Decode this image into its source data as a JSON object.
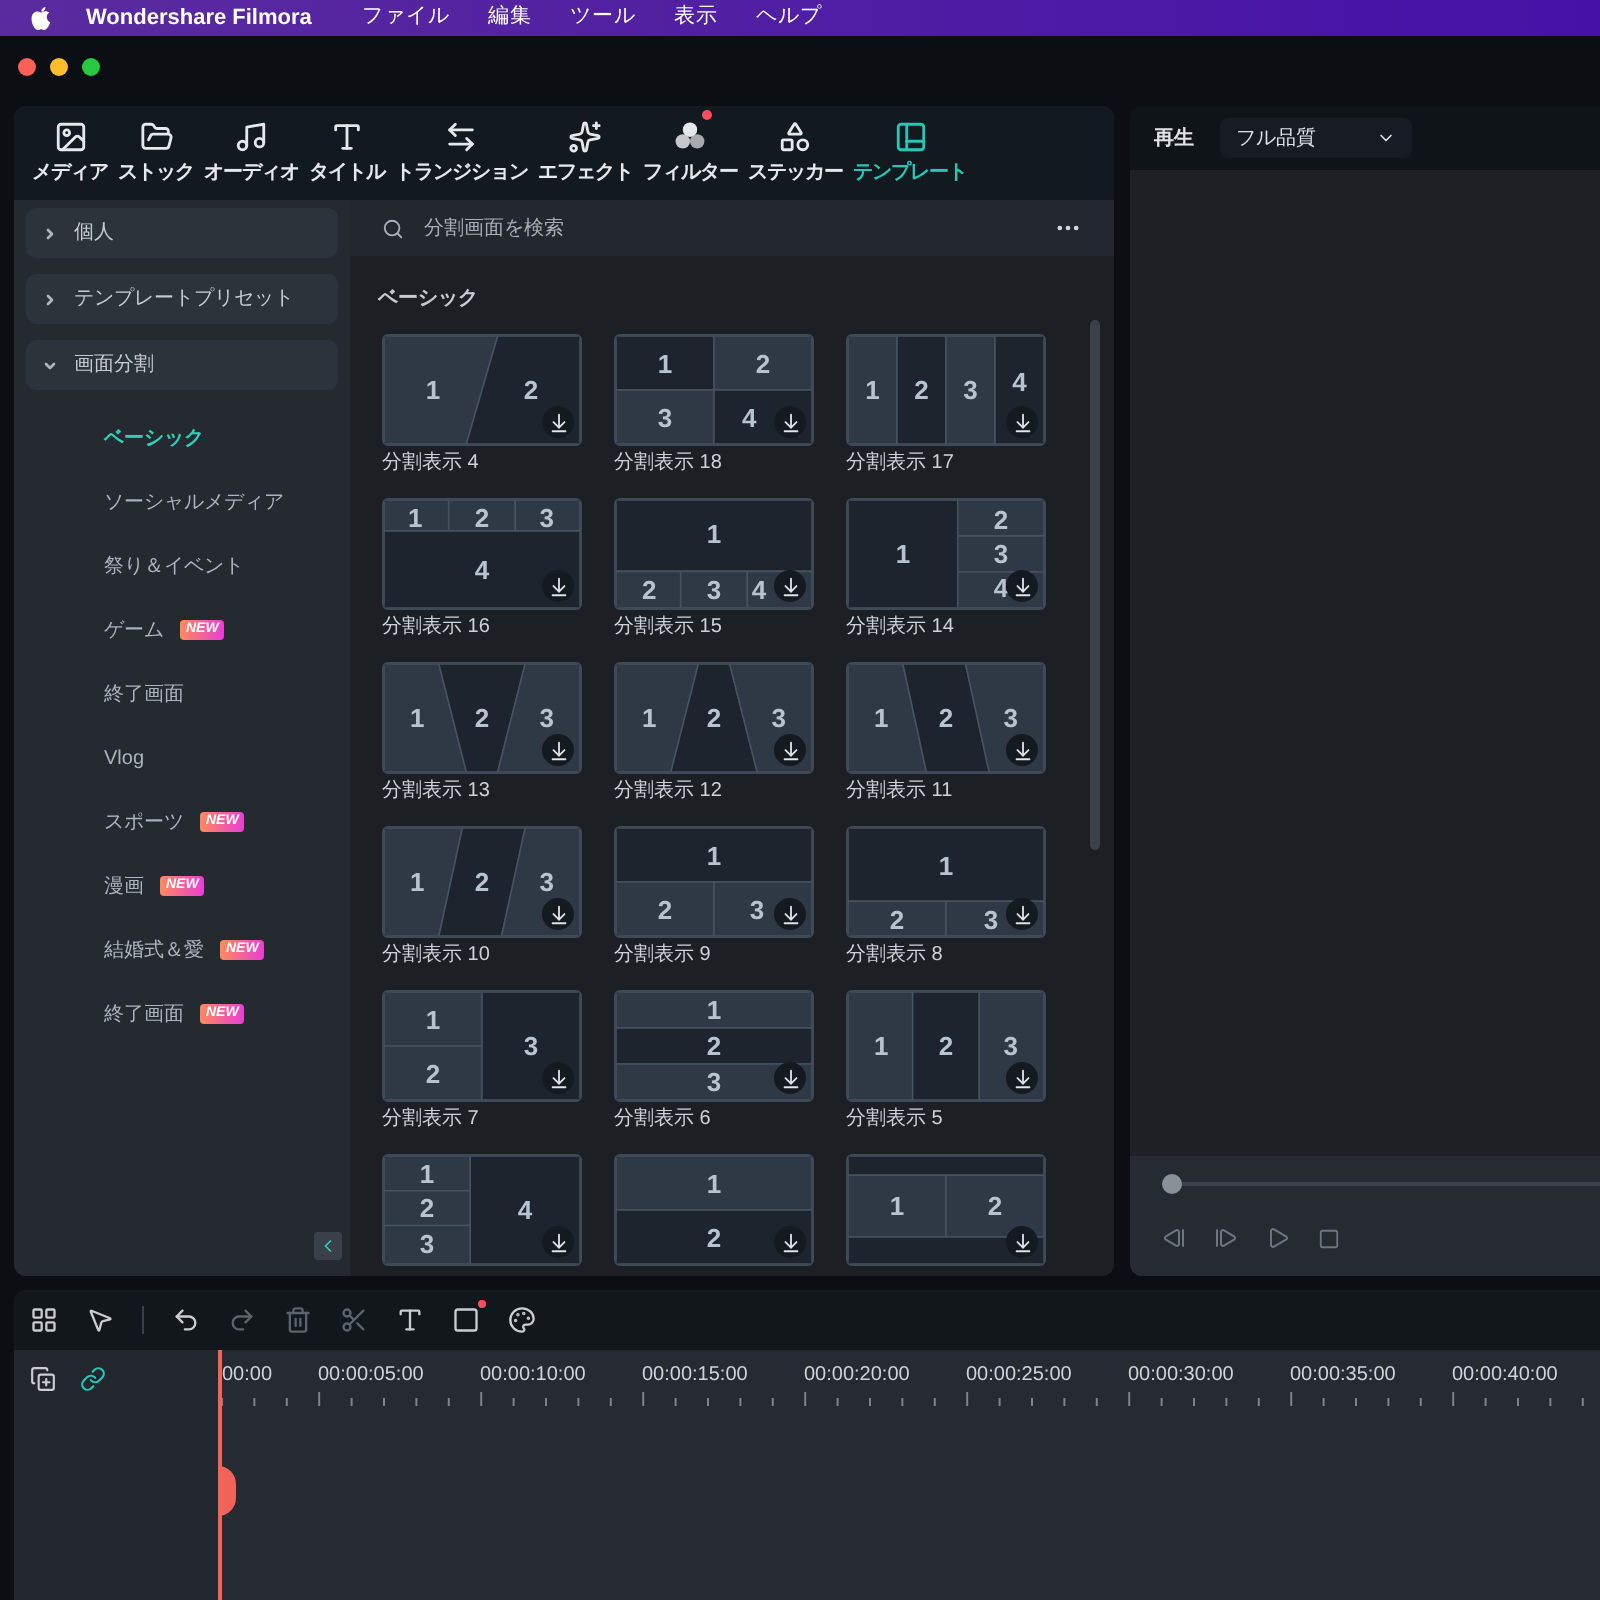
{
  "menu_bar": {
    "app_name": "Wondershare Filmora",
    "menus": [
      "ファイル",
      "編集",
      "ツール",
      "表示",
      "ヘルプ"
    ]
  },
  "toolbar_tabs": [
    {
      "kind": "media",
      "label": "メディア",
      "selected": false,
      "notification": false
    },
    {
      "kind": "stock",
      "label": "ストック",
      "selected": false,
      "notification": false
    },
    {
      "kind": "audio",
      "label": "オーディオ",
      "selected": false,
      "notification": false
    },
    {
      "kind": "title",
      "label": "タイトル",
      "selected": false,
      "notification": false
    },
    {
      "kind": "transition",
      "label": "トランジション",
      "selected": false,
      "notification": false
    },
    {
      "kind": "effect",
      "label": "エフェクト",
      "selected": false,
      "notification": false
    },
    {
      "kind": "filter",
      "label": "フィルター",
      "selected": false,
      "notification": true
    },
    {
      "kind": "sticker",
      "label": "ステッカー",
      "selected": false,
      "notification": false
    },
    {
      "kind": "template",
      "label": "テンプレート",
      "selected": true,
      "notification": false
    }
  ],
  "sidebar": {
    "groups": [
      {
        "label": "個人",
        "expanded": false
      },
      {
        "label": "テンプレートプリセット",
        "expanded": false
      },
      {
        "label": "画面分割",
        "expanded": true,
        "children": [
          {
            "label": "ベーシック",
            "selected": true
          },
          {
            "label": "ソーシャルメディア",
            "selected": false
          },
          {
            "label": "祭り＆イベント",
            "selected": false
          },
          {
            "label": "ゲーム",
            "selected": false,
            "badge": "NEW"
          },
          {
            "label": "終了画面",
            "selected": false
          },
          {
            "label": "Vlog",
            "selected": false
          },
          {
            "label": "スポーツ",
            "selected": false,
            "badge": "NEW"
          },
          {
            "label": "漫画",
            "selected": false,
            "badge": "NEW"
          },
          {
            "label": "結婚式＆愛",
            "selected": false,
            "badge": "NEW"
          },
          {
            "label": "終了画面",
            "selected": false,
            "badge": "NEW"
          }
        ]
      }
    ]
  },
  "search": {
    "placeholder": "分割画面を検索"
  },
  "section_title": "ベーシック",
  "templates": [
    {
      "kind": "diag2",
      "cells": [
        "1",
        "2"
      ],
      "label": "分割表示 4"
    },
    {
      "kind": "grid4",
      "cells": [
        "1",
        "2",
        "3",
        "4"
      ],
      "label": "分割表示 18"
    },
    {
      "kind": "cols4",
      "cells": [
        "1",
        "2",
        "3",
        "4"
      ],
      "label": "分割表示 17"
    },
    {
      "kind": "top3_bottom1",
      "cells": [
        "1",
        "2",
        "3",
        "4"
      ],
      "label": "分割表示 16"
    },
    {
      "kind": "top1_bottom3",
      "cells": [
        "1",
        "2",
        "3",
        "4"
      ],
      "label": "分割表示 15"
    },
    {
      "kind": "left1_right3",
      "cells": [
        "1",
        "2",
        "3",
        "4"
      ],
      "label": "分割表示 14"
    },
    {
      "kind": "vwedge",
      "cells": [
        "1",
        "2",
        "3"
      ],
      "label": "分割表示 13"
    },
    {
      "kind": "awedge",
      "cells": [
        "1",
        "2",
        "3"
      ],
      "label": "分割表示 12"
    },
    {
      "kind": "lean_right",
      "cells": [
        "1",
        "2",
        "3"
      ],
      "label": "分割表示 11"
    },
    {
      "kind": "lean_left",
      "cells": [
        "1",
        "2",
        "3"
      ],
      "label": "分割表示 10"
    },
    {
      "kind": "top1_bottom2",
      "cells": [
        "1",
        "2",
        "3"
      ],
      "label": "分割表示 9"
    },
    {
      "kind": "tall_top_bottom2",
      "cells": [
        "1",
        "2",
        "3"
      ],
      "label": "分割表示 8"
    },
    {
      "kind": "left2_right1",
      "cells": [
        "1",
        "2",
        "3"
      ],
      "label": "分割表示 7"
    },
    {
      "kind": "rows3",
      "cells": [
        "1",
        "2",
        "3"
      ],
      "label": "分割表示 6"
    },
    {
      "kind": "cols3",
      "cells": [
        "1",
        "2",
        "3"
      ],
      "label": "分割表示 5"
    },
    {
      "kind": "left3_right1",
      "cells": [
        "1",
        "2",
        "3",
        "4"
      ]
    },
    {
      "kind": "rows2",
      "cells": [
        "1",
        "2"
      ]
    },
    {
      "kind": "strip_cols2",
      "cells": [
        "1",
        "2"
      ]
    }
  ],
  "player": {
    "title": "再生",
    "quality": "フル品質",
    "progress": {
      "level": 0
    }
  },
  "timeline": {
    "shape_tool_notification": true,
    "ruler": [
      "00:00",
      "00:00:05:00",
      "00:00:10:00",
      "00:00:15:00",
      "00:00:20:00",
      "00:00:25:00",
      "00:00:30:00",
      "00:00:35:00",
      "00:00:40:00"
    ]
  }
}
